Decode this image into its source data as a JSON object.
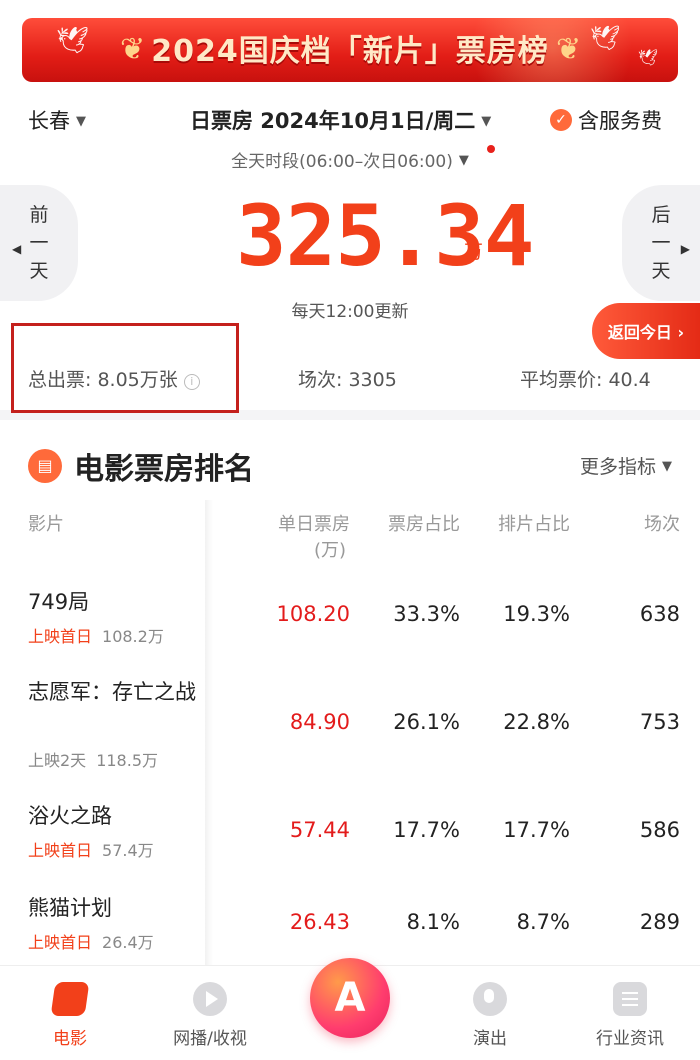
{
  "banner": {
    "title": "2024国庆档「新片」票房榜",
    "leaf_left": "❦",
    "leaf_right": "❦"
  },
  "header": {
    "city": "长春",
    "date_selector": "日票房 2024年10月1日/周二",
    "service_fee": "含服务费",
    "period": "全天时段(06:00–次日06:00)",
    "prev_day": [
      "前",
      "一",
      "天"
    ],
    "next_day": [
      "后",
      "一",
      "天"
    ],
    "gross": "325.34",
    "gross_unit": "万",
    "update_note": "每天12:00更新",
    "today_button": "返回今日 ›"
  },
  "stats": {
    "tickets": "总出票: 8.05万张",
    "shows": "场次: 3305",
    "avg_price": "平均票价: 40.4"
  },
  "ranking": {
    "title": "电影票房排名",
    "more_metrics": "更多指标",
    "columns": {
      "film": "影片",
      "gross_line1": "单日票房",
      "gross_line2": "(万)",
      "share": "票房占比",
      "schedule": "排片占比",
      "shows": "场次"
    },
    "rows": [
      {
        "name": "749局",
        "sub_status": "上映首日",
        "sub_total": "108.2万",
        "gross": "108.20",
        "share": "33.3%",
        "schedule": "19.3%",
        "shows": "638"
      },
      {
        "name": "志愿军：存亡之战",
        "sub_status": "上映2天",
        "sub_total": "118.5万",
        "gross": "84.90",
        "share": "26.1%",
        "schedule": "22.8%",
        "shows": "753"
      },
      {
        "name": "浴火之路",
        "sub_status": "上映首日",
        "sub_total": "57.4万",
        "gross": "57.44",
        "share": "17.7%",
        "schedule": "17.7%",
        "shows": "586"
      },
      {
        "name": "熊猫计划",
        "sub_status": "上映首日",
        "sub_total": "26.4万",
        "gross": "26.43",
        "share": "8.1%",
        "schedule": "8.7%",
        "shows": "289"
      }
    ]
  },
  "tabbar": {
    "movie": "电影",
    "streaming": "网播/收视",
    "shows": "演出",
    "news": "行业资讯",
    "center_logo": "A"
  },
  "colors": {
    "accent": "#f2401a",
    "gross_red": "#e31b1b",
    "highlight_box": "#c4201c"
  },
  "icons": {
    "caret": "caret-down-icon",
    "service": "check-circle-icon",
    "info": "info-icon",
    "film_reel": "film-reel-icon"
  }
}
